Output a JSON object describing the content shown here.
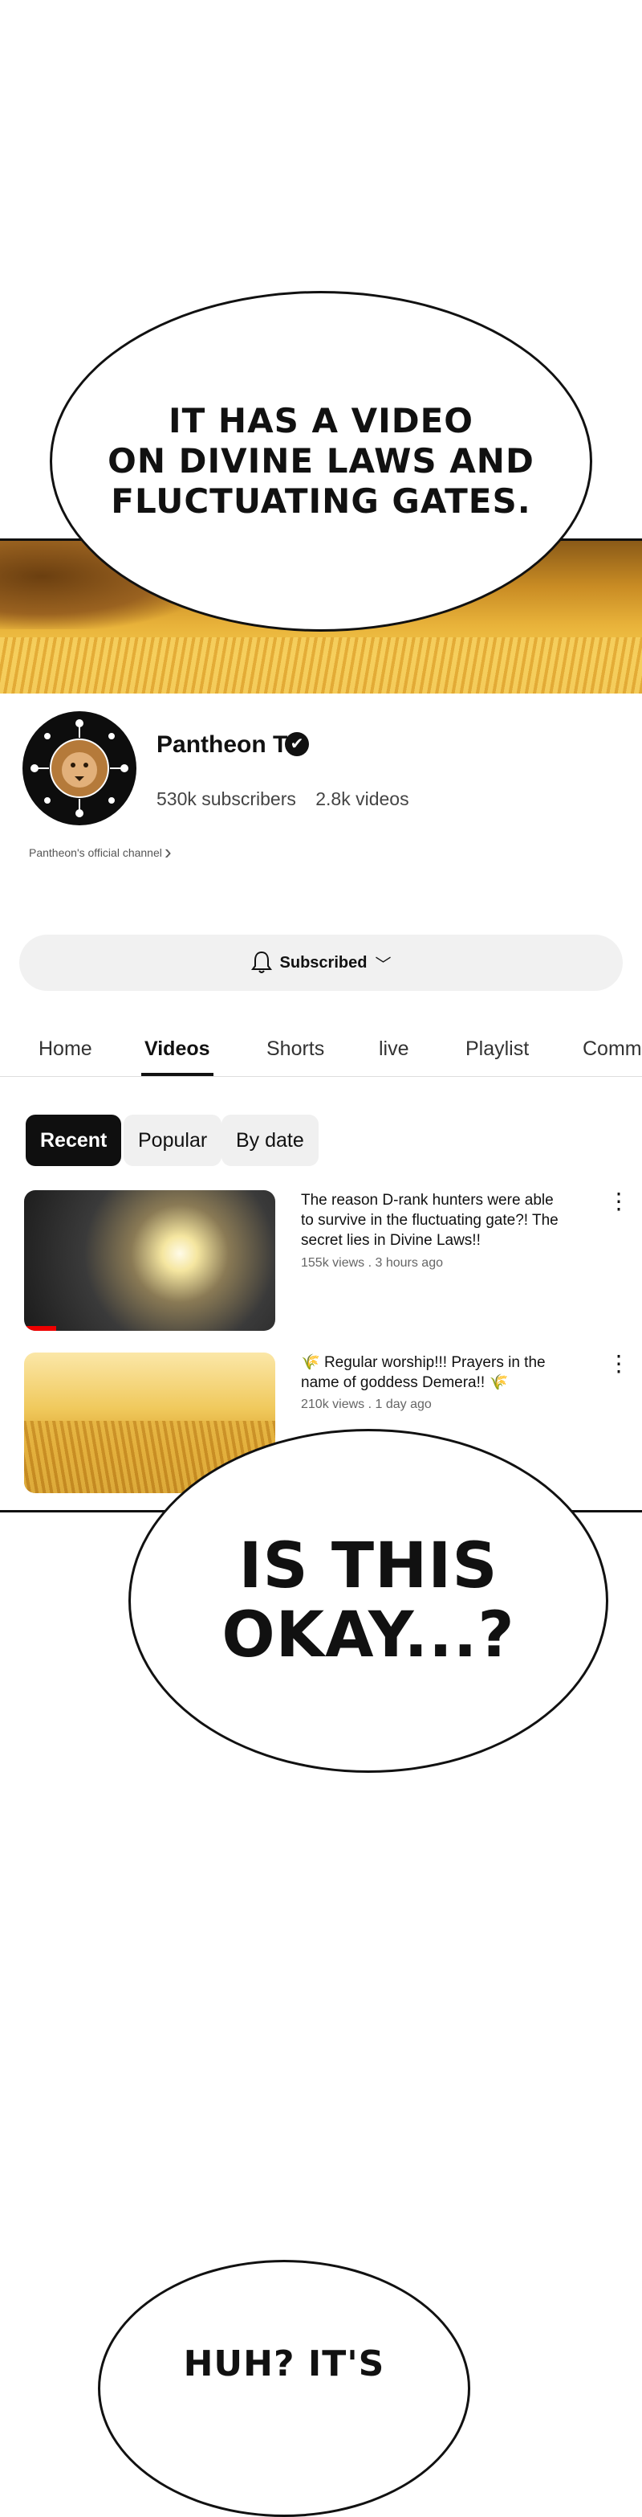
{
  "bubbles": {
    "top": "IT HAS A VIDEO\nON DIVINE LAWS AND\nFLUCTUATING GATES.",
    "middle": "IS THIS\nOKAY...?",
    "bottom": "HUH? IT'S"
  },
  "channel": {
    "name": "Pantheon TV",
    "verified_icon": "✔",
    "subscribers": "530k subscribers",
    "videos_count": "2.8k videos",
    "description": "Pantheon's official channel",
    "subscribe_label": "Subscribed",
    "subscribe_chevron": "﹀"
  },
  "tabs": [
    "Home",
    "Videos",
    "Shorts",
    "live",
    "Playlist",
    "Commu"
  ],
  "filters": [
    "Recent",
    "Popular",
    "By date"
  ],
  "videos": [
    {
      "title": "The reason D-rank hunters were able to survive in the fluctuating gate?! The secret lies in Divine Laws!!",
      "meta": "155k views . 3 hours ago"
    },
    {
      "title": "Regular worship!!! Prayers in the name of goddess Demera!!",
      "meta": "210k views . 1 day ago"
    }
  ],
  "icons": {
    "bell": "bell-icon",
    "more": "more-vertical-icon",
    "chevron": "chevron-right-icon",
    "wheat": "wheat-emoji-icon"
  },
  "colors": {
    "accent_dark": "#0f0f0f",
    "chip_bg": "#f0f0f0",
    "subscribe_bg": "#f1f1f1",
    "progress_red": "#e00000",
    "banner_gold": "#e8b23a"
  }
}
